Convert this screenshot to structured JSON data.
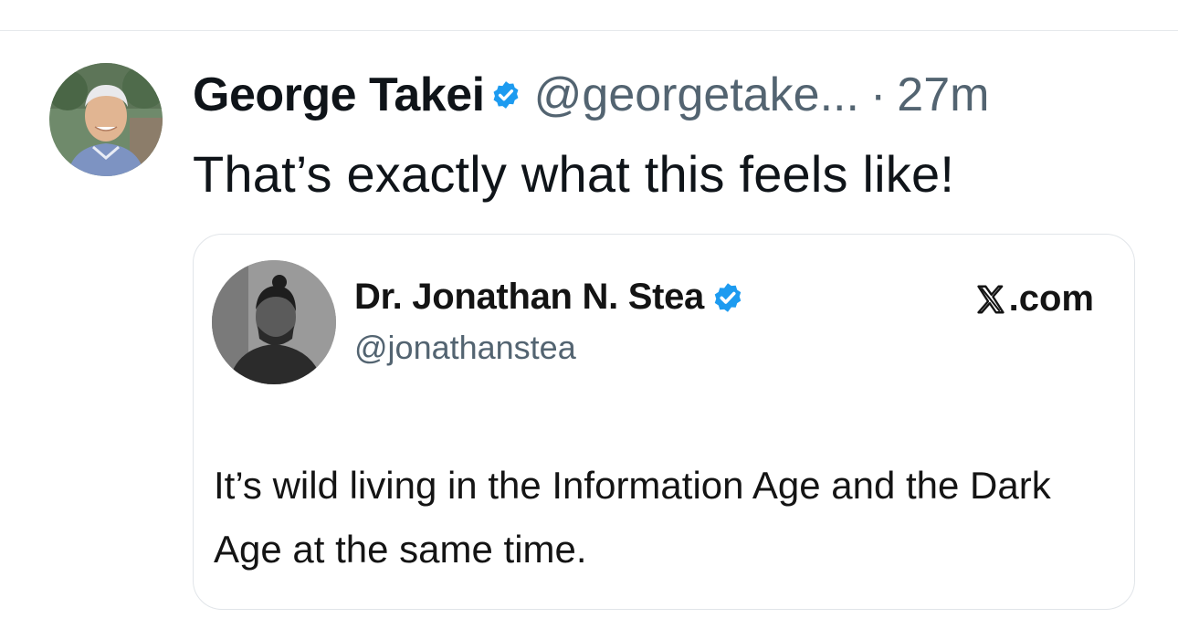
{
  "tweet": {
    "author_name": "George Takei",
    "handle": "@georgetake...",
    "separator": "·",
    "time": "27m",
    "text": "That’s exactly what this feels like!",
    "avatar_icon": "profile-photo",
    "verified_icon": "verified-badge-icon"
  },
  "quote": {
    "author_name": "Dr. Jonathan N. Stea",
    "handle": "@jonathanstea",
    "site_label": ".com",
    "site_icon": "x-logo-icon",
    "text": "It’s wild living in the Information Age and the Dark Age at the same time.",
    "avatar_icon": "profile-photo",
    "verified_icon": "verified-badge-icon"
  },
  "colors": {
    "primary_text": "#0f1419",
    "secondary_text": "#536471",
    "verified_blue": "#1d9bf0",
    "border": "#e1e5e9"
  }
}
